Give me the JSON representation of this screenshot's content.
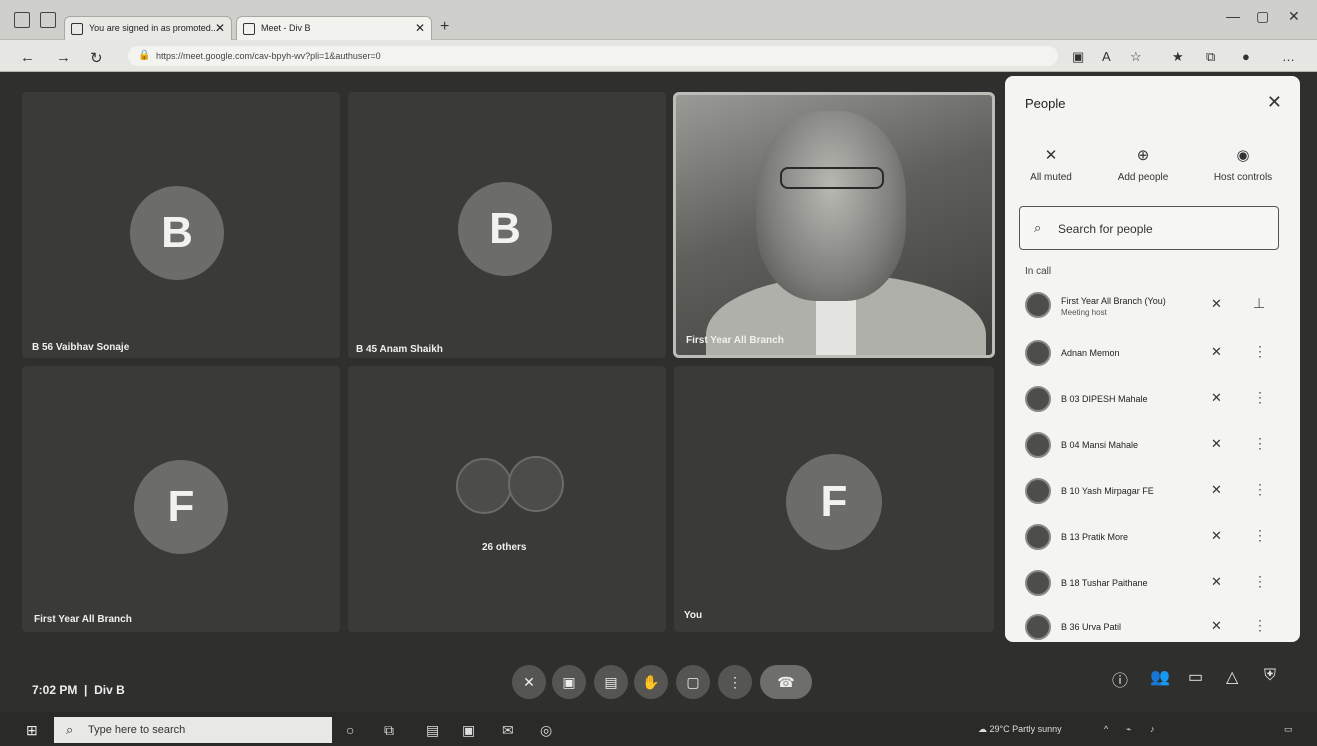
{
  "browser": {
    "tabs": [
      {
        "label": "You are signed in as promoted..."
      },
      {
        "label": "Meet - Div B"
      }
    ],
    "url": "https://meet.google.com/cav-bpyh-wv?pli=1&authuser=0"
  },
  "tiles": {
    "t1": {
      "initial": "B",
      "name": "B 56 Vaibhav Sonaje"
    },
    "t2": {
      "initial": "B",
      "name": "B 45 Anam Shaikh"
    },
    "t3": {
      "name": "First Year All Branch"
    },
    "t4": {
      "initial": "F",
      "name": "First Year All Branch"
    },
    "t5": {
      "name": "26 others"
    },
    "t6": {
      "initial": "F",
      "name": "You"
    }
  },
  "panel": {
    "title": "People",
    "actions": {
      "all_muted": "All muted",
      "add_people": "Add people",
      "host_controls": "Host controls"
    },
    "search_placeholder": "Search for people",
    "section": "In call",
    "people": [
      {
        "name": "First Year All Branch (You)",
        "sub": "Meeting host"
      },
      {
        "name": "Adnan Memon"
      },
      {
        "name": "B 03 DIPESH Mahale"
      },
      {
        "name": "B 04 Mansi Mahale"
      },
      {
        "name": "B 10 Yash Mirpagar FE"
      },
      {
        "name": "B 13 Pratik More"
      },
      {
        "name": "B 18 Tushar Paithane"
      },
      {
        "name": "B 36 Urva Patil"
      }
    ]
  },
  "meeting": {
    "clock": "7:02 PM",
    "code": "Div B"
  },
  "taskbar": {
    "search_placeholder": "Type here to search",
    "weather": "29°C Partly sunny"
  }
}
